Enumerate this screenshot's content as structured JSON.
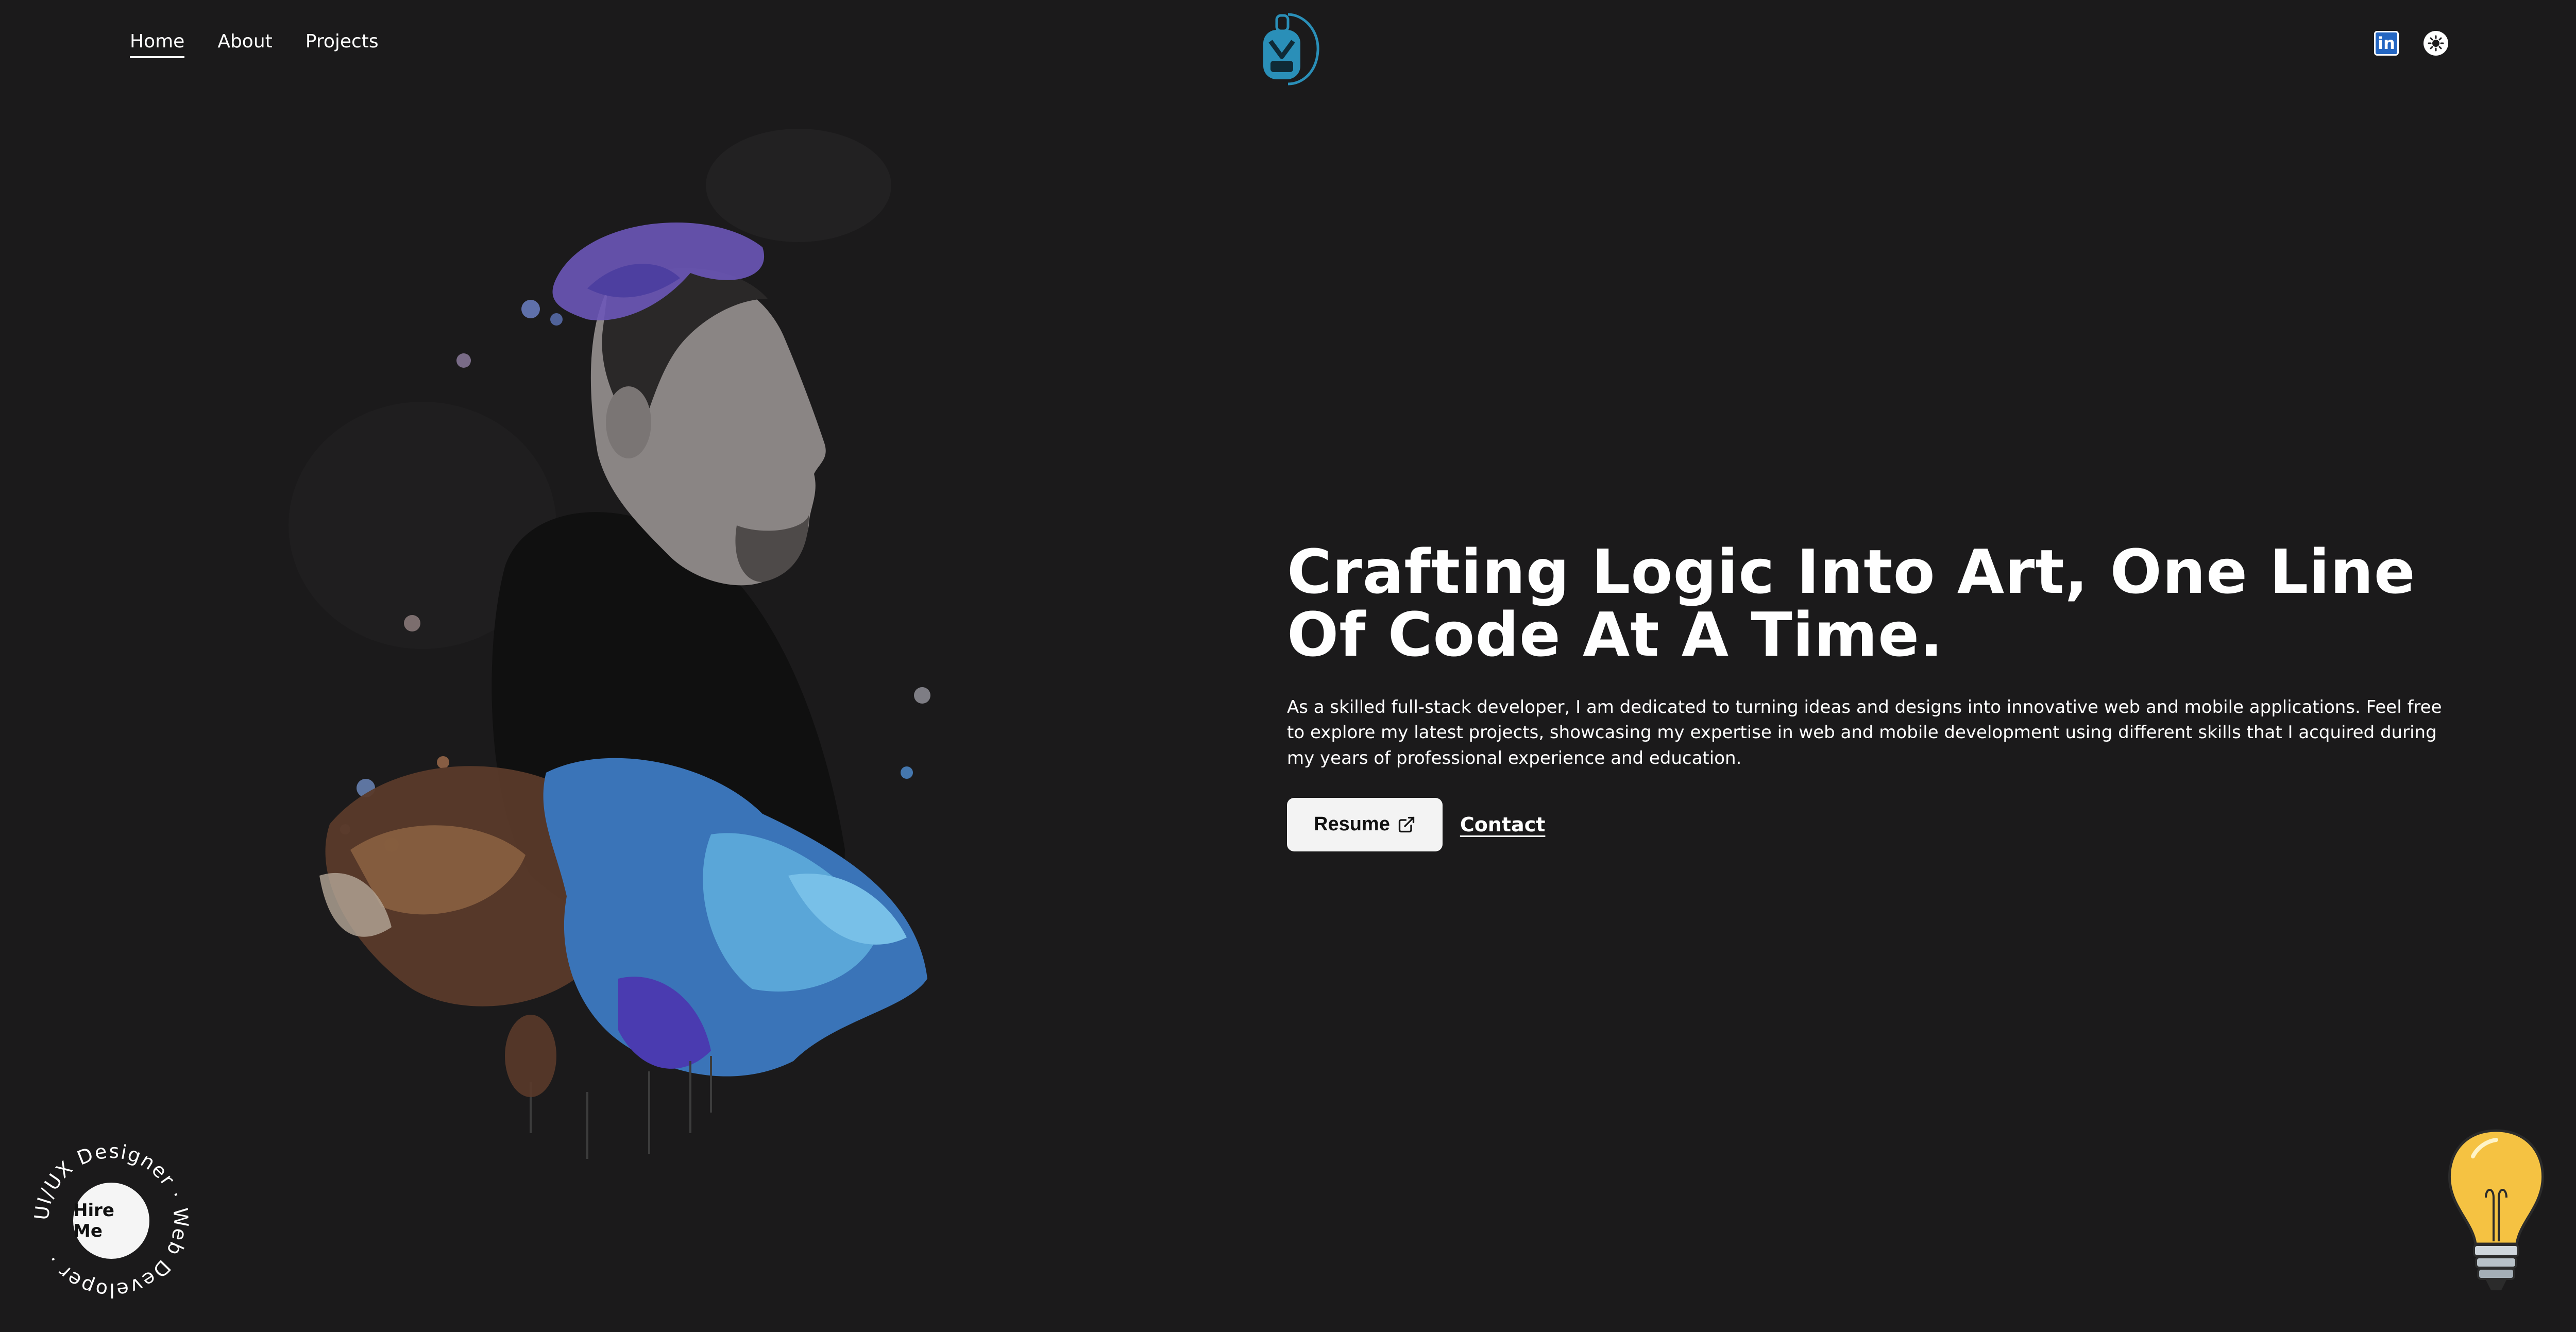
{
  "nav": {
    "items": [
      {
        "label": "Home",
        "active": true
      },
      {
        "label": "About",
        "active": false
      },
      {
        "label": "Projects",
        "active": false
      }
    ]
  },
  "logo": {
    "icon": "monogram-logo-icon",
    "color": "#2a8fb8"
  },
  "social": {
    "linkedin_label": "in",
    "linkedin_icon": "linkedin-icon",
    "theme_icon": "sun-icon"
  },
  "hero": {
    "title_line1": "Crafting Logic Into Art, One Line",
    "title_line2": "Of Code At A Time.",
    "description": "As a skilled full-stack developer, I am dedicated to turning ideas and designs into innovative web and mobile applications. Feel free to explore my latest projects, showcasing my expertise in web and mobile development using different skills that I acquired during my years of professional experience and education.",
    "resume_label": "Resume",
    "resume_icon": "external-link-icon",
    "contact_label": "Contact"
  },
  "hire": {
    "button_label": "Hire Me",
    "ring_text": "UI/UX Designer · Web Developer · "
  },
  "colors": {
    "background": "#1b1a1b",
    "text": "#ffffff",
    "button_bg": "#f3f3f3",
    "linkedin": "#2466c2",
    "bulb": "#f5c242"
  }
}
